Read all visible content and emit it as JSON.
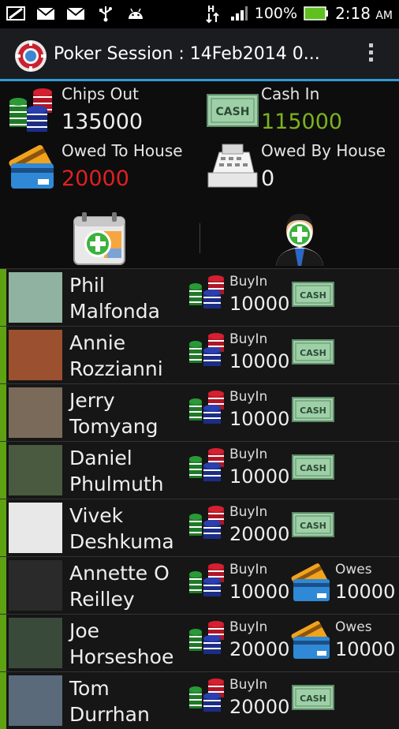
{
  "status_bar": {
    "battery": "100%",
    "time": "2:18",
    "ampm": "AM"
  },
  "header": {
    "title": "Poker Session : 14Feb2014 0..."
  },
  "summary": {
    "chips_out_label": "Chips Out",
    "chips_out_value": "135000",
    "cash_in_label": "Cash In",
    "cash_in_value": "115000",
    "owed_to_house_label": "Owed To House",
    "owed_to_house_value": "20000",
    "owed_by_house_label": "Owed By House",
    "owed_by_house_value": "0"
  },
  "colors": {
    "accent": "#2f9bd6",
    "cash_in": "#7cb31e",
    "owed_to_house": "#e02020",
    "player_bar": "#5ea212"
  },
  "players": [
    {
      "name_line1": "Phil",
      "name_line2": "Malfonda",
      "buyin_label": "BuyIn",
      "buyin": "10000",
      "status": "cash"
    },
    {
      "name_line1": "Annie",
      "name_line2": "Rozzianni",
      "buyin_label": "BuyIn",
      "buyin": "10000",
      "status": "cash"
    },
    {
      "name_line1": "Jerry",
      "name_line2": "Tomyang",
      "buyin_label": "BuyIn",
      "buyin": "10000",
      "status": "cash"
    },
    {
      "name_line1": "Daniel",
      "name_line2": "Phulmuth",
      "buyin_label": "BuyIn",
      "buyin": "10000",
      "status": "cash"
    },
    {
      "name_line1": "Vivek",
      "name_line2": "Deshkuma",
      "buyin_label": "BuyIn",
      "buyin": "20000",
      "status": "cash"
    },
    {
      "name_line1": "Annette O",
      "name_line2": "Reilley",
      "buyin_label": "BuyIn",
      "buyin": "10000",
      "status": "owes",
      "owes_label": "Owes",
      "owes": "10000"
    },
    {
      "name_line1": "Joe",
      "name_line2": "Horseshoe",
      "buyin_label": "BuyIn",
      "buyin": "20000",
      "status": "owes",
      "owes_label": "Owes",
      "owes": "10000"
    },
    {
      "name_line1": "Tom",
      "name_line2": "Durrhan",
      "buyin_label": "BuyIn",
      "buyin": "20000",
      "status": "cash"
    }
  ],
  "icons": {
    "app_logo": "poker-chip-logo-icon",
    "chips": "poker-chips-icon",
    "cash": "cash-banknote-icon",
    "card": "credit-card-icon",
    "register": "cash-register-icon",
    "add_session": "add-calendar-icon",
    "add_player": "add-player-icon",
    "overflow": "overflow-menu-icon"
  }
}
